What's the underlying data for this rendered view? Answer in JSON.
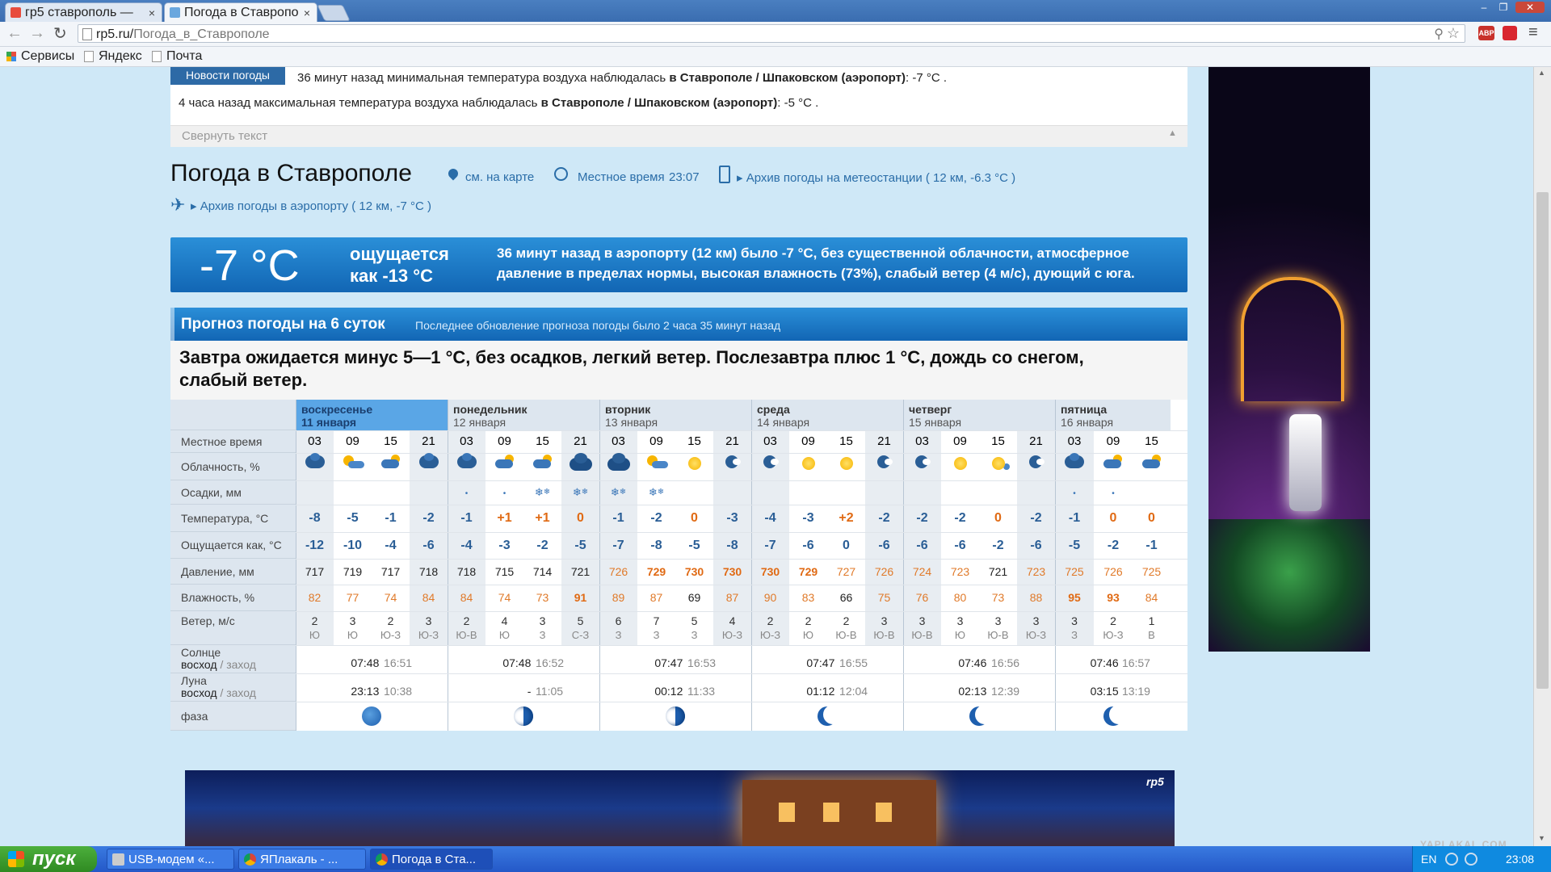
{
  "browser": {
    "tabs": [
      {
        "label": "гр5 ставрополь — ",
        "close": "×"
      },
      {
        "label": "Погода в Ставропо",
        "close": "×"
      }
    ],
    "url_domain": "rp5.ru/",
    "url_path": "Погода_в_Ставрополе",
    "bookmarks": [
      "Сервисы",
      "Яндекс",
      "Почта"
    ]
  },
  "news": {
    "badge": "Новости погоды",
    "line1_pre": "36 минут назад минимальная температура воздуха наблюдалась ",
    "line1_bold": "в Ставрополе / Шпаковском (аэропорт)",
    "line1_post": ": -7 °C .",
    "line2_pre": "4 часа назад максимальная температура воздуха наблюдалась ",
    "line2_bold": "в Ставрополе / Шпаковском (аэропорт)",
    "line2_post": ": -5 °C .",
    "collapse": "Свернуть текст"
  },
  "header": {
    "title": "Погода в Ставрополе",
    "map_link": "см. на карте",
    "local_time_label": "Местное время",
    "local_time": "23:07",
    "archive_station": "Архив погоды на метеостанции ( 12 км, -6.3 °C )",
    "archive_airport": "Архив погоды в аэропорту ( 12 км, -7 °C )"
  },
  "current": {
    "temp": "-7 °C",
    "feels_1": "ощущается",
    "feels_2": "как -13 °C",
    "desc_1": "36 минут назад в аэропорту (12 км) было -7 °C, без существенной облачности, атмосферное",
    "desc_2": "давление в пределах нормы, высокая влажность (73%), слабый ветер (4 м/с), дующий с юга."
  },
  "forecast": {
    "title": "Прогноз погоды на 6 суток",
    "updated": "Последнее обновление прогноза погоды было 2 часа 35 минут назад",
    "summary_1": "Завтра ожидается минус 5—1 °C, без осадков, легкий ветер. Послезавтра плюс 1 °C, дождь со снегом,",
    "summary_2": "слабый ветер.",
    "labels": {
      "time": "Местное время",
      "cloud": "Облачность, %",
      "precip": "Осадки, мм",
      "temp": "Температура, °C",
      "feels": "Ощущается как, °C",
      "pressure": "Давление, мм",
      "humidity": "Влажность, %",
      "wind": "Ветер, м/с",
      "sun_1": "Солнце",
      "sun_2a": "восход",
      "sun_2b": " / заход",
      "moon_1": "Луна",
      "moon_2a": "восход",
      "moon_2b": " / заход",
      "phase": "фаза"
    },
    "days": [
      {
        "name": "воскресенье",
        "date": "11 января",
        "sunrise": "07:48",
        "sunset": "16:51",
        "moonrise": "23:13",
        "moonset": "10:38"
      },
      {
        "name": "понедельник",
        "date": "12 января",
        "sunrise": "07:48",
        "sunset": "16:52",
        "moonrise": "-",
        "moonset": "11:05"
      },
      {
        "name": "вторник",
        "date": "13 января",
        "sunrise": "07:47",
        "sunset": "16:53",
        "moonrise": "00:12",
        "moonset": "11:33"
      },
      {
        "name": "среда",
        "date": "14 января",
        "sunrise": "07:47",
        "sunset": "16:55",
        "moonrise": "01:12",
        "moonset": "12:04"
      },
      {
        "name": "четверг",
        "date": "15 января",
        "sunrise": "07:46",
        "sunset": "16:56",
        "moonrise": "02:13",
        "moonset": "12:39"
      },
      {
        "name": "пятница",
        "date": "16 января",
        "sunrise": "07:46",
        "sunset": "16:57",
        "moonrise": "03:15",
        "moonset": "13:19"
      }
    ],
    "hours": [
      "03",
      "09",
      "15",
      "21",
      "03",
      "09",
      "15",
      "21",
      "03",
      "09",
      "15",
      "21",
      "03",
      "09",
      "15",
      "21",
      "03",
      "09",
      "15",
      "21",
      "03",
      "09",
      "15"
    ],
    "cloud_icons": [
      "cloudy-night",
      "partly-sunny",
      "partly-cloudy",
      "cloudy-night",
      "cloudy-night",
      "partly-cloudy",
      "partly-cloudy",
      "heavy-cloud",
      "heavy-cloud",
      "partly-sunny",
      "sun",
      "clear-night",
      "clear-night",
      "sun",
      "sun",
      "clear-night",
      "clear-night",
      "sun",
      "sun-cloud",
      "clear-night",
      "cloudy-night",
      "partly-cloudy",
      "partly-cloudy"
    ],
    "precip": [
      "",
      "",
      "",
      "",
      "light",
      "light",
      "snow",
      "snow",
      "snow",
      "snow",
      "",
      "",
      "",
      "",
      "",
      "",
      "",
      "",
      "",
      "",
      "light",
      "light",
      ""
    ],
    "temp": [
      "-8",
      "-5",
      "-1",
      "-2",
      "-1",
      "+1",
      "+1",
      "0",
      "-1",
      "-2",
      "0",
      "-3",
      "-4",
      "-3",
      "+2",
      "-2",
      "-2",
      "-2",
      "0",
      "-2",
      "-1",
      "0",
      "0"
    ],
    "feels": [
      "-12",
      "-10",
      "-4",
      "-6",
      "-4",
      "-3",
      "-2",
      "-5",
      "-7",
      "-8",
      "-5",
      "-8",
      "-7",
      "-6",
      "0",
      "-6",
      "-6",
      "-6",
      "-2",
      "-6",
      "-5",
      "-2",
      "-1"
    ],
    "pressure": [
      "717",
      "719",
      "717",
      "718",
      "718",
      "715",
      "714",
      "721",
      "726",
      "729",
      "730",
      "730",
      "730",
      "729",
      "727",
      "726",
      "724",
      "723",
      "721",
      "723",
      "725",
      "726",
      "725"
    ],
    "pressure_style": [
      "n",
      "n",
      "n",
      "n",
      "n",
      "n",
      "n",
      "n",
      "o",
      "b",
      "b",
      "b",
      "b",
      "b",
      "o",
      "o",
      "o",
      "o",
      "n",
      "o",
      "o",
      "o",
      "o"
    ],
    "humidity": [
      "82",
      "77",
      "74",
      "84",
      "84",
      "74",
      "73",
      "91",
      "89",
      "87",
      "69",
      "87",
      "90",
      "83",
      "66",
      "75",
      "76",
      "80",
      "73",
      "88",
      "95",
      "93",
      "84"
    ],
    "humidity_style": [
      "o",
      "o",
      "o",
      "o",
      "o",
      "o",
      "o",
      "b",
      "o",
      "o",
      "n",
      "o",
      "o",
      "o",
      "n",
      "o",
      "o",
      "o",
      "o",
      "o",
      "b",
      "b",
      "o"
    ],
    "wind_speed": [
      "2",
      "3",
      "2",
      "3",
      "2",
      "4",
      "3",
      "5",
      "6",
      "7",
      "5",
      "4",
      "2",
      "2",
      "2",
      "3",
      "3",
      "3",
      "3",
      "3",
      "3",
      "2",
      "1"
    ],
    "wind_dir": [
      "Ю",
      "Ю",
      "Ю-З",
      "Ю-З",
      "Ю-В",
      "Ю",
      "З",
      "С-З",
      "З",
      "З",
      "З",
      "Ю-З",
      "Ю-З",
      "Ю",
      "Ю-В",
      "Ю-В",
      "Ю-В",
      "Ю",
      "Ю-В",
      "Ю-З",
      "З",
      "Ю-З",
      "В"
    ],
    "moon_phases": [
      "waning-gibbous",
      "waning-half",
      "waning-half",
      "waning-crescent",
      "waning-crescent",
      "waning-crescent"
    ]
  },
  "taskbar": {
    "start": "пуск",
    "items": [
      "USB-модем «...",
      "ЯПлакаль - ...",
      "Погода в Ста..."
    ],
    "lang": "EN",
    "clock": "23:08"
  },
  "watermark": "YAPLAKAL.COM",
  "banner_logo": "rp5",
  "colors": {
    "accent_blue": "#1f78c8",
    "orange": "#e06a14",
    "neg_blue": "#2a5e96"
  }
}
